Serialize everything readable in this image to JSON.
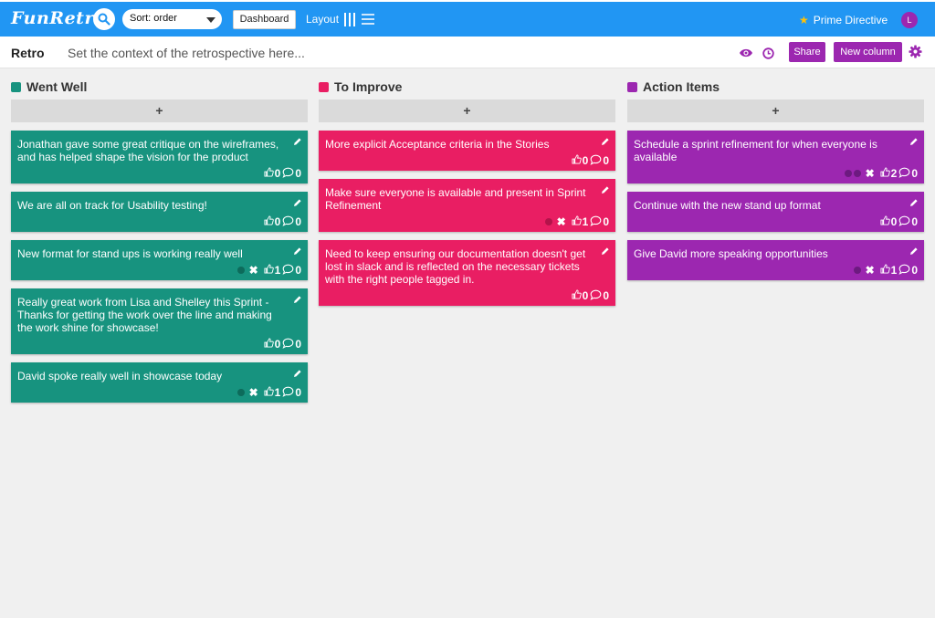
{
  "app": {
    "logo": "FunRetro"
  },
  "topbar": {
    "sort_value": "Sort: order",
    "dashboard_label": "Dashboard",
    "layout_label": "Layout",
    "prime_directive_label": "Prime Directive",
    "avatar_initial": "L"
  },
  "board": {
    "title": "Retro",
    "context_placeholder": "Set the context of the retrospective here...",
    "share_label": "Share",
    "new_column_label": "New column"
  },
  "columns": [
    {
      "title": "Went Well",
      "color": "#17937f",
      "add_label": "+",
      "cards": [
        {
          "text": "Jonathan gave some great critique on the wireframes, and has helped shape the vision for the product",
          "votes": "0",
          "comments": "0",
          "voted": false
        },
        {
          "text": "We are all on track for Usability testing!",
          "votes": "0",
          "comments": "0",
          "voted": false
        },
        {
          "text": "New format for stand ups is working really well",
          "votes": "1",
          "comments": "0",
          "voted": true
        },
        {
          "text": "Really great work from Lisa and Shelley this Sprint - Thanks for getting the work over the line and making the work shine for showcase!",
          "votes": "0",
          "comments": "0",
          "voted": false
        },
        {
          "text": "David spoke really well in showcase today",
          "votes": "1",
          "comments": "0",
          "voted": true
        }
      ]
    },
    {
      "title": "To Improve",
      "color": "#e91e63",
      "add_label": "+",
      "cards": [
        {
          "text": "More explicit Acceptance criteria in the Stories",
          "votes": "0",
          "comments": "0",
          "voted": false
        },
        {
          "text": "Make sure everyone is available and present in Sprint Refinement",
          "votes": "1",
          "comments": "0",
          "voted": true
        },
        {
          "text": "Need to keep ensuring our documentation doesn't get lost in slack and is reflected on the necessary tickets with the right people tagged in.",
          "votes": "0",
          "comments": "0",
          "voted": false
        }
      ]
    },
    {
      "title": "Action Items",
      "color": "#9c27b0",
      "add_label": "+",
      "cards": [
        {
          "text": "Schedule a sprint refinement for when everyone is available",
          "votes": "2",
          "comments": "0",
          "voted": true
        },
        {
          "text": "Continue with the new stand up format",
          "votes": "0",
          "comments": "0",
          "voted": false
        },
        {
          "text": "Give David more speaking opportunities",
          "votes": "1",
          "comments": "0",
          "voted": true
        }
      ]
    }
  ]
}
